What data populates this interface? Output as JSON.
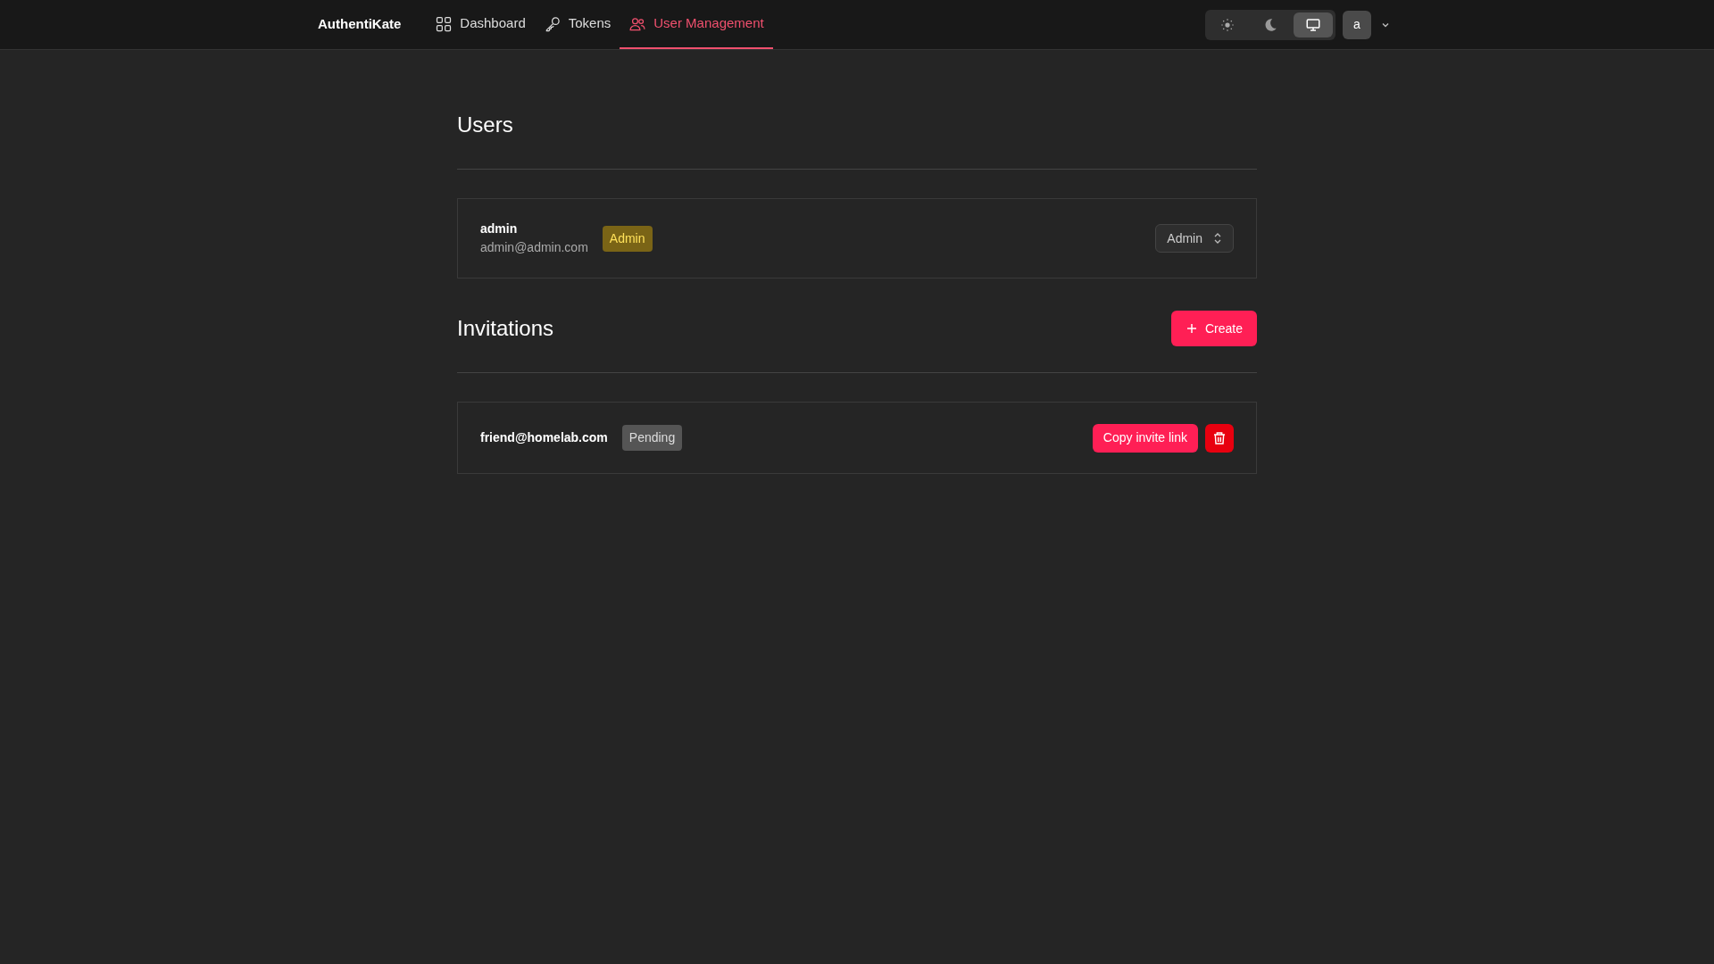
{
  "nav": {
    "brand": "AuthentiKate",
    "tabs": [
      {
        "label": "Dashboard",
        "kind": "grid",
        "selected": false
      },
      {
        "label": "Tokens",
        "kind": "key",
        "selected": false
      },
      {
        "label": "User Management",
        "kind": "users",
        "selected": true
      }
    ],
    "theme": [
      {
        "kind": "light",
        "selected": false
      },
      {
        "kind": "dark",
        "selected": false
      },
      {
        "kind": "system",
        "selected": true
      }
    ],
    "avatar": "a"
  },
  "users": {
    "title": "Users",
    "rows": [
      {
        "name": "admin",
        "email": "admin@admin.com",
        "badge": "Admin",
        "role": "Admin"
      }
    ]
  },
  "invitations": {
    "title": "Invitations",
    "create": "Create",
    "rows": [
      {
        "email": "friend@homelab.com",
        "status": "Pending",
        "copy": "Copy invite link"
      }
    ]
  }
}
